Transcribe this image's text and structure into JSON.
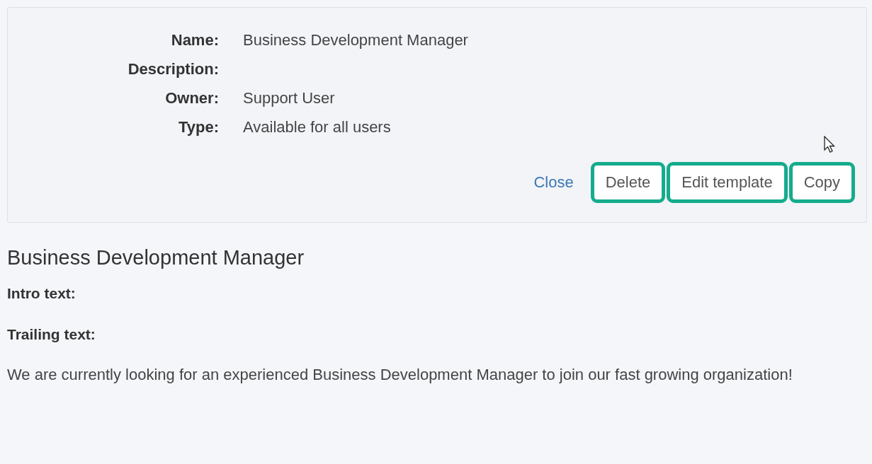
{
  "details": {
    "fields": [
      {
        "label": "Name:",
        "value": "Business Development Manager"
      },
      {
        "label": "Description:"
      },
      {
        "label": "Owner:",
        "value": "Support User"
      },
      {
        "label": "Type:",
        "value": "Available for all users"
      }
    ],
    "close_link": "Close",
    "buttons": [
      {
        "label": "Delete",
        "highlighted": true
      },
      {
        "label": "Edit template",
        "highlighted": true
      },
      {
        "label": "Copy",
        "highlighted": true
      }
    ]
  },
  "template": {
    "title": "Business Development Manager",
    "intro_label": "Intro text:",
    "trailing_label": "Trailing text:",
    "body": "We are currently looking for an experienced Business Development Manager to join our fast growing organization!"
  }
}
